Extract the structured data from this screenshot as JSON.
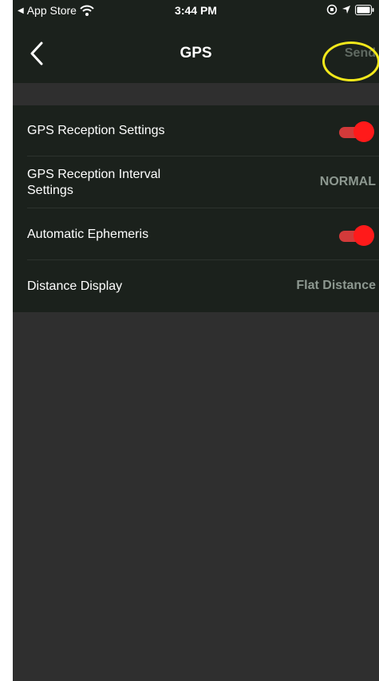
{
  "status_bar": {
    "back_app": "App Store",
    "time": "3:44 PM"
  },
  "nav": {
    "title": "GPS",
    "send_label": "Send"
  },
  "settings": [
    {
      "label": "GPS Reception Settings",
      "control": "toggle",
      "on": true
    },
    {
      "label": "GPS Reception Interval\nSettings",
      "control": "value",
      "value": "NORMAL"
    },
    {
      "label": "Automatic Ephemeris",
      "control": "toggle",
      "on": true
    },
    {
      "label": "Distance Display",
      "control": "value",
      "value": "Flat Distance"
    }
  ],
  "colors": {
    "toggle_on": "#ff1a1a",
    "highlight": "#f2e81b",
    "bar_bg": "#1b211c",
    "page_bg": "#2f2f2f"
  },
  "icons": [
    "back-arrow-icon",
    "wifi-icon",
    "location-icon",
    "lock-rotation-icon",
    "battery-icon",
    "chevron-left-icon"
  ]
}
